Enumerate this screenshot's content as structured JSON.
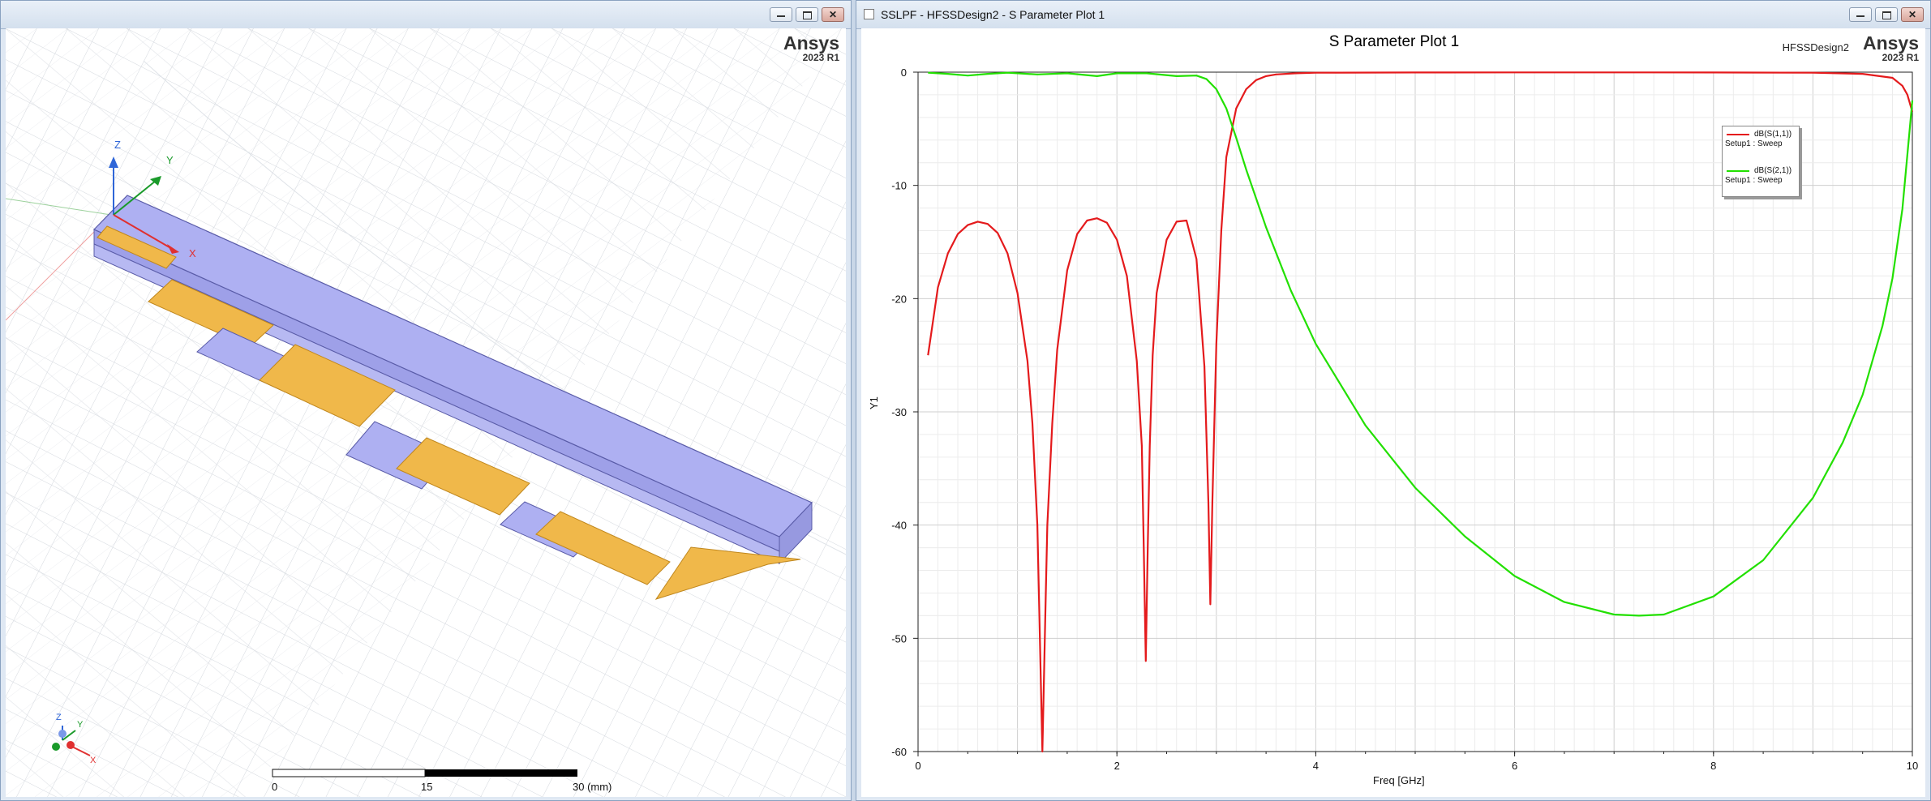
{
  "left_window": {
    "brand": "Ansys",
    "version": "2023 R1",
    "axes": {
      "z": "Z",
      "y": "Y",
      "x": "X"
    },
    "mini_axes": {
      "z": "Z",
      "y": "Y",
      "x": "X"
    },
    "ruler": {
      "start": "0",
      "mid": "15",
      "end": "30 (mm)"
    }
  },
  "right_window": {
    "title": "SSLPF - HFSSDesign2 - S Parameter Plot 1",
    "brand": "Ansys",
    "version": "2023 R1",
    "design_name": "HFSSDesign2"
  },
  "colors": {
    "s11": "#e41a1c",
    "s21": "#22e000",
    "grid": "#dcdcdc",
    "substrate": "#aeb0f2",
    "copper": "#f0b84a"
  },
  "chart_data": {
    "type": "line",
    "title": "S Parameter Plot 1",
    "xlabel": "Freq [GHz]",
    "ylabel": "Y1",
    "xlim": [
      0,
      10
    ],
    "ylim": [
      -60,
      0
    ],
    "x_ticks": [
      "0",
      "2",
      "4",
      "6",
      "8",
      "10"
    ],
    "y_ticks": [
      "0",
      "-10",
      "-20",
      "-30",
      "-40",
      "-50",
      "-60"
    ],
    "grid": true,
    "legend_position": "top-right",
    "series": [
      {
        "name": "dB(S(1,1))",
        "setup": "Setup1 : Sweep",
        "x": [
          0.1,
          0.2,
          0.3,
          0.4,
          0.5,
          0.6,
          0.7,
          0.8,
          0.9,
          1.0,
          1.1,
          1.15,
          1.2,
          1.22,
          1.25,
          1.28,
          1.3,
          1.35,
          1.4,
          1.5,
          1.6,
          1.7,
          1.8,
          1.9,
          2.0,
          2.1,
          2.2,
          2.25,
          2.27,
          2.29,
          2.31,
          2.33,
          2.36,
          2.4,
          2.5,
          2.6,
          2.7,
          2.8,
          2.88,
          2.92,
          2.94,
          2.96,
          3.0,
          3.05,
          3.1,
          3.2,
          3.3,
          3.4,
          3.5,
          3.6,
          3.8,
          4.0,
          5.0,
          6.0,
          7.0,
          8.0,
          9.0,
          9.5,
          9.8,
          9.9,
          9.95,
          10.0
        ],
        "y": [
          -25,
          -19,
          -16,
          -14.3,
          -13.5,
          -13.2,
          -13.4,
          -14.2,
          -16,
          -19.5,
          -25.5,
          -31,
          -40,
          -48,
          -60,
          -48,
          -40,
          -31,
          -24.5,
          -17.5,
          -14.3,
          -13.1,
          -12.9,
          -13.3,
          -14.8,
          -18,
          -25.5,
          -33,
          -42,
          -52,
          -42,
          -33,
          -25,
          -19.5,
          -14.8,
          -13.2,
          -13.1,
          -16.5,
          -26,
          -38,
          -47,
          -38,
          -24,
          -14,
          -7.5,
          -3.2,
          -1.5,
          -0.7,
          -0.35,
          -0.2,
          -0.1,
          -0.05,
          -0.03,
          -0.02,
          -0.02,
          -0.03,
          -0.05,
          -0.15,
          -0.5,
          -1.2,
          -2,
          -3.5
        ]
      },
      {
        "name": "dB(S(2,1))",
        "setup": "Setup1 : Sweep",
        "x": [
          0.1,
          0.3,
          0.5,
          0.7,
          0.9,
          1.2,
          1.5,
          1.8,
          2.0,
          2.3,
          2.6,
          2.8,
          2.9,
          3.0,
          3.1,
          3.2,
          3.3,
          3.5,
          3.75,
          4.0,
          4.5,
          5.0,
          5.5,
          6.0,
          6.5,
          7.0,
          7.25,
          7.5,
          8.0,
          8.5,
          9.0,
          9.3,
          9.5,
          9.7,
          9.8,
          9.9,
          10.0
        ],
        "y": [
          -0.05,
          -0.15,
          -0.3,
          -0.15,
          -0.05,
          -0.2,
          -0.1,
          -0.35,
          -0.1,
          -0.1,
          -0.35,
          -0.3,
          -0.6,
          -1.5,
          -3.2,
          -5.8,
          -8.6,
          -13.7,
          -19.3,
          -24,
          -31.2,
          -36.7,
          -41,
          -44.5,
          -46.8,
          -47.9,
          -48,
          -47.9,
          -46.3,
          -43.1,
          -37.6,
          -32.7,
          -28.5,
          -22.4,
          -18.2,
          -12.1,
          -2.5
        ]
      }
    ]
  }
}
